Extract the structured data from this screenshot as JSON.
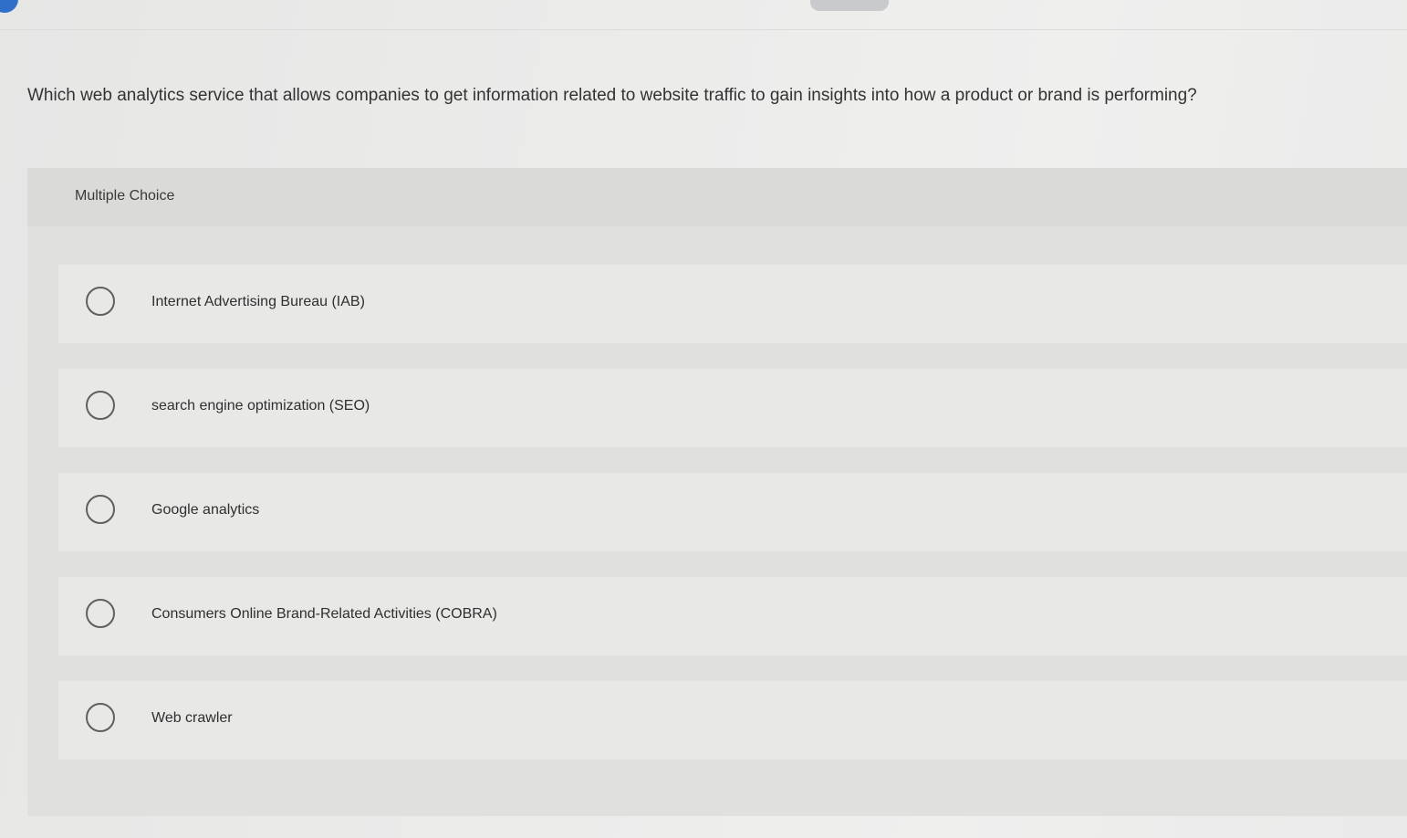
{
  "question": {
    "text": "Which web analytics service that allows companies to get information related to website traffic to gain insights into how a product or brand is performing?"
  },
  "choices": {
    "header": "Multiple Choice",
    "options": [
      {
        "label": "Internet Advertising Bureau (IAB)"
      },
      {
        "label": "search engine optimization (SEO)"
      },
      {
        "label": "Google analytics"
      },
      {
        "label": "Consumers Online Brand-Related Activities (COBRA)"
      },
      {
        "label": "Web crawler"
      }
    ]
  },
  "colors": {
    "background": "#e9e9e8",
    "panel": "#e0e0df",
    "option": "#e8e8e7",
    "radio_border": "#5f5f5f",
    "accent": "#2f6fc9"
  },
  "icons": {
    "corner": "info-icon",
    "option_radio": "radio-button-icon"
  }
}
